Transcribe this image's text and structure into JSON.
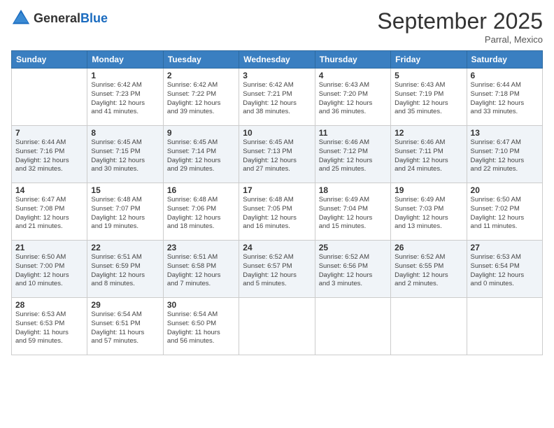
{
  "logo": {
    "general": "General",
    "blue": "Blue"
  },
  "header": {
    "month": "September 2025",
    "location": "Parral, Mexico"
  },
  "weekdays": [
    "Sunday",
    "Monday",
    "Tuesday",
    "Wednesday",
    "Thursday",
    "Friday",
    "Saturday"
  ],
  "weeks": [
    [
      {
        "day": "",
        "info": ""
      },
      {
        "day": "1",
        "info": "Sunrise: 6:42 AM\nSunset: 7:23 PM\nDaylight: 12 hours\nand 41 minutes."
      },
      {
        "day": "2",
        "info": "Sunrise: 6:42 AM\nSunset: 7:22 PM\nDaylight: 12 hours\nand 39 minutes."
      },
      {
        "day": "3",
        "info": "Sunrise: 6:42 AM\nSunset: 7:21 PM\nDaylight: 12 hours\nand 38 minutes."
      },
      {
        "day": "4",
        "info": "Sunrise: 6:43 AM\nSunset: 7:20 PM\nDaylight: 12 hours\nand 36 minutes."
      },
      {
        "day": "5",
        "info": "Sunrise: 6:43 AM\nSunset: 7:19 PM\nDaylight: 12 hours\nand 35 minutes."
      },
      {
        "day": "6",
        "info": "Sunrise: 6:44 AM\nSunset: 7:18 PM\nDaylight: 12 hours\nand 33 minutes."
      }
    ],
    [
      {
        "day": "7",
        "info": "Sunrise: 6:44 AM\nSunset: 7:16 PM\nDaylight: 12 hours\nand 32 minutes."
      },
      {
        "day": "8",
        "info": "Sunrise: 6:45 AM\nSunset: 7:15 PM\nDaylight: 12 hours\nand 30 minutes."
      },
      {
        "day": "9",
        "info": "Sunrise: 6:45 AM\nSunset: 7:14 PM\nDaylight: 12 hours\nand 29 minutes."
      },
      {
        "day": "10",
        "info": "Sunrise: 6:45 AM\nSunset: 7:13 PM\nDaylight: 12 hours\nand 27 minutes."
      },
      {
        "day": "11",
        "info": "Sunrise: 6:46 AM\nSunset: 7:12 PM\nDaylight: 12 hours\nand 25 minutes."
      },
      {
        "day": "12",
        "info": "Sunrise: 6:46 AM\nSunset: 7:11 PM\nDaylight: 12 hours\nand 24 minutes."
      },
      {
        "day": "13",
        "info": "Sunrise: 6:47 AM\nSunset: 7:10 PM\nDaylight: 12 hours\nand 22 minutes."
      }
    ],
    [
      {
        "day": "14",
        "info": "Sunrise: 6:47 AM\nSunset: 7:08 PM\nDaylight: 12 hours\nand 21 minutes."
      },
      {
        "day": "15",
        "info": "Sunrise: 6:48 AM\nSunset: 7:07 PM\nDaylight: 12 hours\nand 19 minutes."
      },
      {
        "day": "16",
        "info": "Sunrise: 6:48 AM\nSunset: 7:06 PM\nDaylight: 12 hours\nand 18 minutes."
      },
      {
        "day": "17",
        "info": "Sunrise: 6:48 AM\nSunset: 7:05 PM\nDaylight: 12 hours\nand 16 minutes."
      },
      {
        "day": "18",
        "info": "Sunrise: 6:49 AM\nSunset: 7:04 PM\nDaylight: 12 hours\nand 15 minutes."
      },
      {
        "day": "19",
        "info": "Sunrise: 6:49 AM\nSunset: 7:03 PM\nDaylight: 12 hours\nand 13 minutes."
      },
      {
        "day": "20",
        "info": "Sunrise: 6:50 AM\nSunset: 7:02 PM\nDaylight: 12 hours\nand 11 minutes."
      }
    ],
    [
      {
        "day": "21",
        "info": "Sunrise: 6:50 AM\nSunset: 7:00 PM\nDaylight: 12 hours\nand 10 minutes."
      },
      {
        "day": "22",
        "info": "Sunrise: 6:51 AM\nSunset: 6:59 PM\nDaylight: 12 hours\nand 8 minutes."
      },
      {
        "day": "23",
        "info": "Sunrise: 6:51 AM\nSunset: 6:58 PM\nDaylight: 12 hours\nand 7 minutes."
      },
      {
        "day": "24",
        "info": "Sunrise: 6:52 AM\nSunset: 6:57 PM\nDaylight: 12 hours\nand 5 minutes."
      },
      {
        "day": "25",
        "info": "Sunrise: 6:52 AM\nSunset: 6:56 PM\nDaylight: 12 hours\nand 3 minutes."
      },
      {
        "day": "26",
        "info": "Sunrise: 6:52 AM\nSunset: 6:55 PM\nDaylight: 12 hours\nand 2 minutes."
      },
      {
        "day": "27",
        "info": "Sunrise: 6:53 AM\nSunset: 6:54 PM\nDaylight: 12 hours\nand 0 minutes."
      }
    ],
    [
      {
        "day": "28",
        "info": "Sunrise: 6:53 AM\nSunset: 6:53 PM\nDaylight: 11 hours\nand 59 minutes."
      },
      {
        "day": "29",
        "info": "Sunrise: 6:54 AM\nSunset: 6:51 PM\nDaylight: 11 hours\nand 57 minutes."
      },
      {
        "day": "30",
        "info": "Sunrise: 6:54 AM\nSunset: 6:50 PM\nDaylight: 11 hours\nand 56 minutes."
      },
      {
        "day": "",
        "info": ""
      },
      {
        "day": "",
        "info": ""
      },
      {
        "day": "",
        "info": ""
      },
      {
        "day": "",
        "info": ""
      }
    ]
  ]
}
